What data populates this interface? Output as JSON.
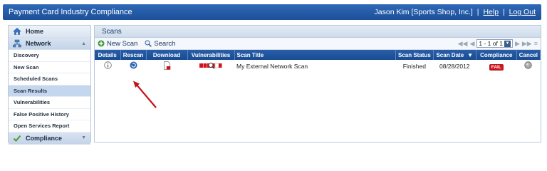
{
  "app": {
    "title": "Payment Card Industry Compliance"
  },
  "user": {
    "name": "Jason Kim [Sports Shop, Inc.]",
    "help": "Help",
    "logout": "Log Out",
    "separator": "|"
  },
  "sidebar": {
    "home": "Home",
    "network": "Network",
    "items": [
      "Discovery",
      "New Scan",
      "Scheduled Scans",
      "Scan Results",
      "Vulnerabilities",
      "False Positive History",
      "Open Services Report"
    ],
    "active_index": 3,
    "compliance": "Compliance"
  },
  "main": {
    "title": "Scans",
    "toolbar": {
      "new_scan": "New Scan",
      "search": "Search"
    },
    "pager": {
      "range": "1 - 1 of 1"
    },
    "columns": [
      "Details",
      "Rescan",
      "Download",
      "Vulnerabilities",
      "Scan Title",
      "Scan Status",
      "Scan Date",
      "Compliance",
      "Cancel"
    ],
    "rows": [
      {
        "scan_title": "My External Network Scan",
        "scan_status": "Finished",
        "scan_date": "08/28/2012",
        "compliance": "FAIL"
      }
    ]
  },
  "colors": {
    "header_blue": "#1c4f98",
    "fail_red": "#c9151e",
    "arrow_red": "#c0141c"
  },
  "icons": [
    "home-icon",
    "network-icon",
    "compliance-icon",
    "new-scan-icon",
    "search-icon",
    "info-icon",
    "rescan-icon",
    "download-icon",
    "vulnerabilities-icon",
    "cancel-icon"
  ]
}
